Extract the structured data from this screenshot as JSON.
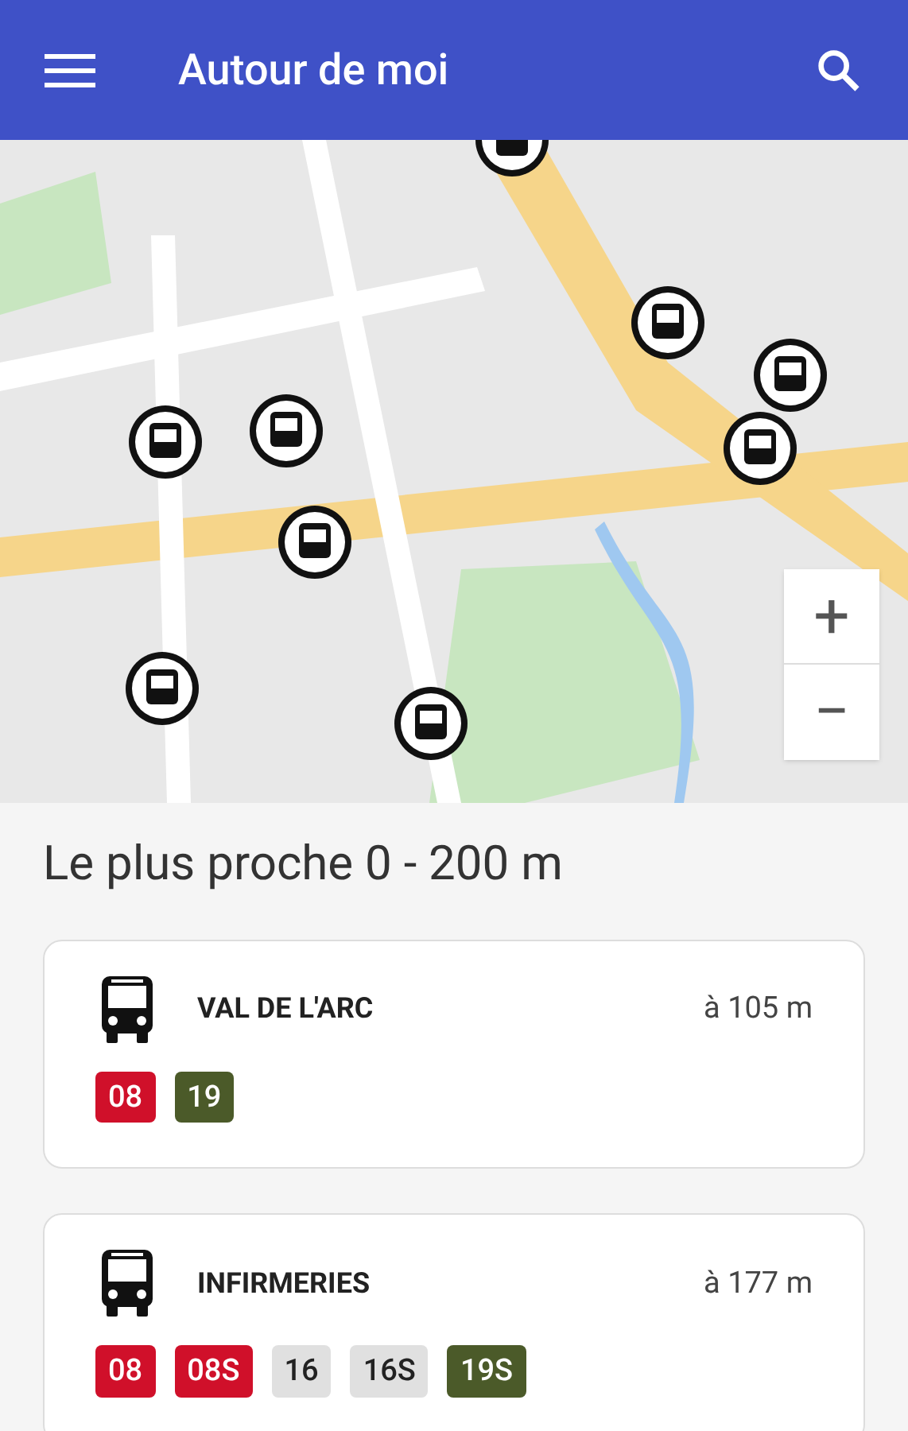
{
  "app_bar": {
    "title": "Autour de moi"
  },
  "map": {
    "zoom_in": "+",
    "zoom_out": "−"
  },
  "section_title": "Le plus proche 0 - 200 m",
  "stops": [
    {
      "name": "VAL DE L'ARC",
      "distance": "à 105 m",
      "lines": [
        {
          "label": "08",
          "color": "#d0102a"
        },
        {
          "label": "19",
          "color": "#4b5a29"
        }
      ]
    },
    {
      "name": "INFIRMERIES",
      "distance": "à 177 m",
      "lines": [
        {
          "label": "08",
          "color": "#d0102a"
        },
        {
          "label": "08S",
          "color": "#d0102a"
        },
        {
          "label": "16",
          "color": "#e0e0e0"
        },
        {
          "label": "16S",
          "color": "#e0e0e0"
        },
        {
          "label": "19S",
          "color": "#4b5a29"
        }
      ]
    }
  ]
}
